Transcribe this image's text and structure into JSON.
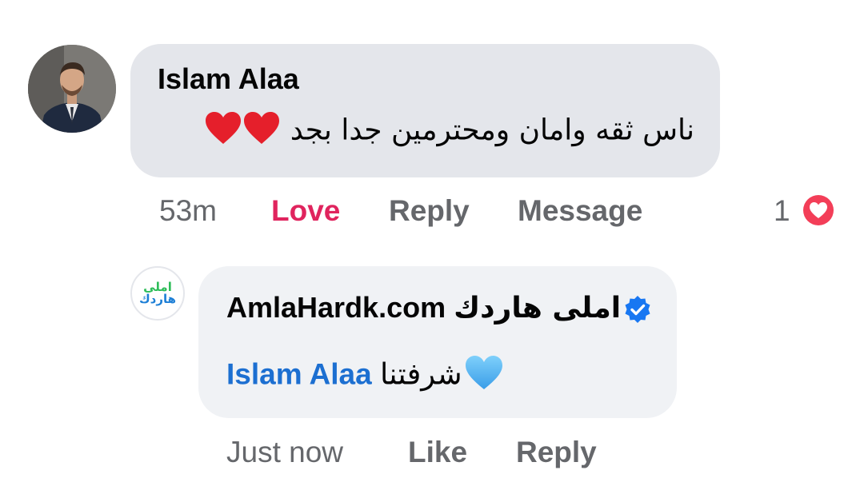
{
  "comment": {
    "author": "Islam Alaa",
    "text": "ناس ثقه وامان ومحترمين جدا بجد",
    "emoji": "❤️❤️",
    "time": "53m",
    "reaction_label": "Love",
    "reply_label": "Reply",
    "message_label": "Message",
    "reaction_count": "1",
    "reaction_color": "#e0245e"
  },
  "reply": {
    "author_latin": "AmlaHardk.com",
    "author_arabic": "املى هاردك",
    "avatar_line1": "املى",
    "avatar_line2": "هاردك",
    "mention": "Islam Alaa",
    "text": "شرفتنا",
    "emoji": "💙",
    "time": "Just now",
    "like_label": "Like",
    "reply_label": "Reply",
    "mention_color": "#1c6fd1"
  }
}
